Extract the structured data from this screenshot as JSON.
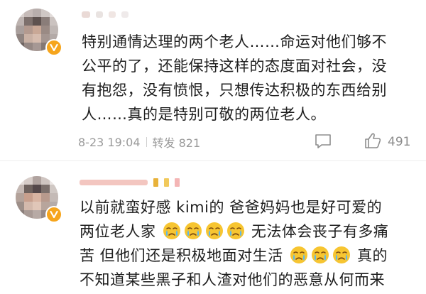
{
  "comment1": {
    "lines": [
      "特别通情达理的两个老人……命运对他们够不",
      "公平的了，还能保持这样的态度面对社会，没",
      "有抱怨，没有愤恨，只想传达积极的东西给别",
      "人……真的是特别可敬的两位老人。"
    ],
    "time": "8-23 19:04",
    "repost": "转发 821",
    "likes": "491",
    "reply_icon": "comment-bubble-icon",
    "like_icon": "thumbs-up-icon",
    "badge_icon": "v-badge-icon"
  },
  "comment2": {
    "line1": "以前就蛮好感 kimi的 爸爸妈妈也是好可爱的",
    "line2_a": "两位老人家",
    "line2_b": "无法体会丧子有多痛",
    "line3_a": "苦 但他们还是积极地面对生活",
    "line3_b": "真的",
    "line4": "不知道某些黑子和人渣对他们的恶意从何而来",
    "emoji": "crying-face-emoji",
    "badge_icon": "v-badge-icon"
  },
  "colors": {
    "text": "#1e1e1e",
    "meta": "#9a9a9a",
    "badge": "#f6a51d",
    "emoji_face": "#f7c531",
    "tears": "#5bb8ee"
  }
}
